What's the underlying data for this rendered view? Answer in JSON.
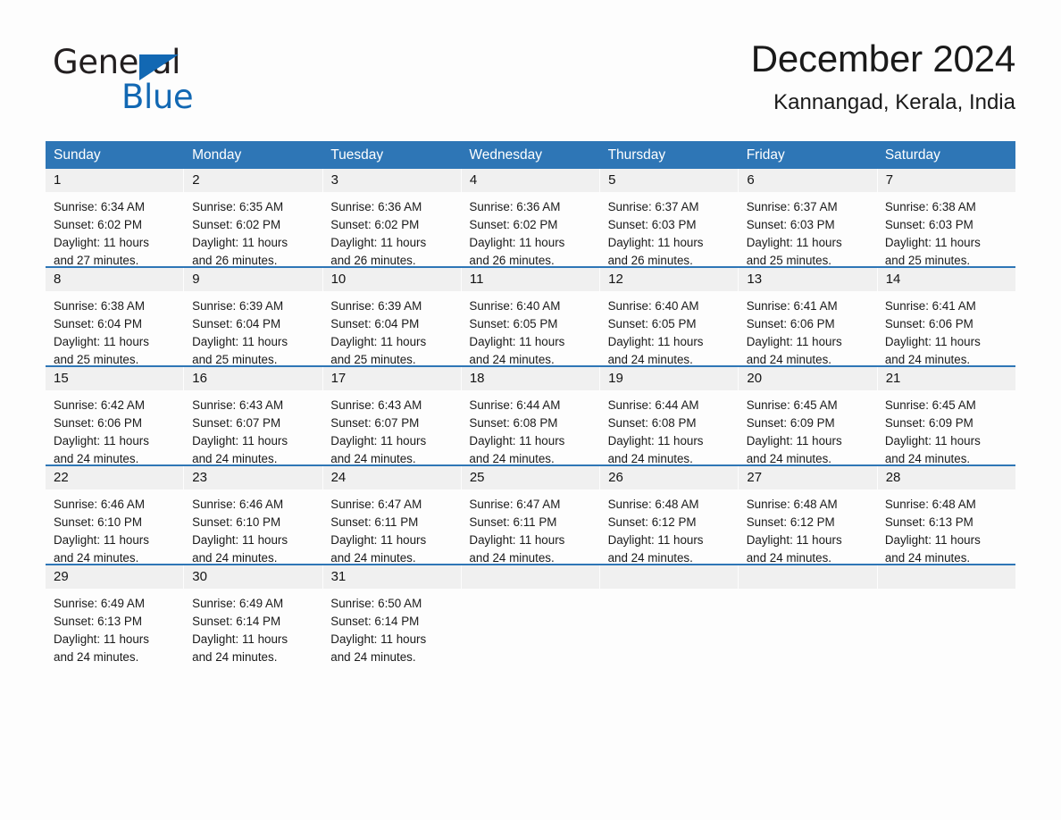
{
  "brand": {
    "name_top": "General",
    "name_bottom": "Blue",
    "triangle_color": "#1268b3"
  },
  "header": {
    "title": "December 2024",
    "subtitle": "Kannangad, Kerala, India"
  },
  "theme": {
    "header_blue": "#2e76b6",
    "daynum_gray": "#f0f0f0",
    "page_background": "#fdfdfd",
    "text_color": "#1a1a1a"
  },
  "weekdays": [
    "Sunday",
    "Monday",
    "Tuesday",
    "Wednesday",
    "Thursday",
    "Friday",
    "Saturday"
  ],
  "labels": {
    "sunrise_prefix": "Sunrise:",
    "sunset_prefix": "Sunset:",
    "daylight_prefix": "Daylight:"
  },
  "weeks": [
    {
      "days": [
        {
          "date": "1",
          "line1": "Sunrise: 6:34 AM",
          "line2": "Sunset: 6:02 PM",
          "line3": "Daylight: 11 hours",
          "line4": "and 27 minutes."
        },
        {
          "date": "2",
          "line1": "Sunrise: 6:35 AM",
          "line2": "Sunset: 6:02 PM",
          "line3": "Daylight: 11 hours",
          "line4": "and 26 minutes."
        },
        {
          "date": "3",
          "line1": "Sunrise: 6:36 AM",
          "line2": "Sunset: 6:02 PM",
          "line3": "Daylight: 11 hours",
          "line4": "and 26 minutes."
        },
        {
          "date": "4",
          "line1": "Sunrise: 6:36 AM",
          "line2": "Sunset: 6:02 PM",
          "line3": "Daylight: 11 hours",
          "line4": "and 26 minutes."
        },
        {
          "date": "5",
          "line1": "Sunrise: 6:37 AM",
          "line2": "Sunset: 6:03 PM",
          "line3": "Daylight: 11 hours",
          "line4": "and 26 minutes."
        },
        {
          "date": "6",
          "line1": "Sunrise: 6:37 AM",
          "line2": "Sunset: 6:03 PM",
          "line3": "Daylight: 11 hours",
          "line4": "and 25 minutes."
        },
        {
          "date": "7",
          "line1": "Sunrise: 6:38 AM",
          "line2": "Sunset: 6:03 PM",
          "line3": "Daylight: 11 hours",
          "line4": "and 25 minutes."
        }
      ]
    },
    {
      "days": [
        {
          "date": "8",
          "line1": "Sunrise: 6:38 AM",
          "line2": "Sunset: 6:04 PM",
          "line3": "Daylight: 11 hours",
          "line4": "and 25 minutes."
        },
        {
          "date": "9",
          "line1": "Sunrise: 6:39 AM",
          "line2": "Sunset: 6:04 PM",
          "line3": "Daylight: 11 hours",
          "line4": "and 25 minutes."
        },
        {
          "date": "10",
          "line1": "Sunrise: 6:39 AM",
          "line2": "Sunset: 6:04 PM",
          "line3": "Daylight: 11 hours",
          "line4": "and 25 minutes."
        },
        {
          "date": "11",
          "line1": "Sunrise: 6:40 AM",
          "line2": "Sunset: 6:05 PM",
          "line3": "Daylight: 11 hours",
          "line4": "and 24 minutes."
        },
        {
          "date": "12",
          "line1": "Sunrise: 6:40 AM",
          "line2": "Sunset: 6:05 PM",
          "line3": "Daylight: 11 hours",
          "line4": "and 24 minutes."
        },
        {
          "date": "13",
          "line1": "Sunrise: 6:41 AM",
          "line2": "Sunset: 6:06 PM",
          "line3": "Daylight: 11 hours",
          "line4": "and 24 minutes."
        },
        {
          "date": "14",
          "line1": "Sunrise: 6:41 AM",
          "line2": "Sunset: 6:06 PM",
          "line3": "Daylight: 11 hours",
          "line4": "and 24 minutes."
        }
      ]
    },
    {
      "days": [
        {
          "date": "15",
          "line1": "Sunrise: 6:42 AM",
          "line2": "Sunset: 6:06 PM",
          "line3": "Daylight: 11 hours",
          "line4": "and 24 minutes."
        },
        {
          "date": "16",
          "line1": "Sunrise: 6:43 AM",
          "line2": "Sunset: 6:07 PM",
          "line3": "Daylight: 11 hours",
          "line4": "and 24 minutes."
        },
        {
          "date": "17",
          "line1": "Sunrise: 6:43 AM",
          "line2": "Sunset: 6:07 PM",
          "line3": "Daylight: 11 hours",
          "line4": "and 24 minutes."
        },
        {
          "date": "18",
          "line1": "Sunrise: 6:44 AM",
          "line2": "Sunset: 6:08 PM",
          "line3": "Daylight: 11 hours",
          "line4": "and 24 minutes."
        },
        {
          "date": "19",
          "line1": "Sunrise: 6:44 AM",
          "line2": "Sunset: 6:08 PM",
          "line3": "Daylight: 11 hours",
          "line4": "and 24 minutes."
        },
        {
          "date": "20",
          "line1": "Sunrise: 6:45 AM",
          "line2": "Sunset: 6:09 PM",
          "line3": "Daylight: 11 hours",
          "line4": "and 24 minutes."
        },
        {
          "date": "21",
          "line1": "Sunrise: 6:45 AM",
          "line2": "Sunset: 6:09 PM",
          "line3": "Daylight: 11 hours",
          "line4": "and 24 minutes."
        }
      ]
    },
    {
      "days": [
        {
          "date": "22",
          "line1": "Sunrise: 6:46 AM",
          "line2": "Sunset: 6:10 PM",
          "line3": "Daylight: 11 hours",
          "line4": "and 24 minutes."
        },
        {
          "date": "23",
          "line1": "Sunrise: 6:46 AM",
          "line2": "Sunset: 6:10 PM",
          "line3": "Daylight: 11 hours",
          "line4": "and 24 minutes."
        },
        {
          "date": "24",
          "line1": "Sunrise: 6:47 AM",
          "line2": "Sunset: 6:11 PM",
          "line3": "Daylight: 11 hours",
          "line4": "and 24 minutes."
        },
        {
          "date": "25",
          "line1": "Sunrise: 6:47 AM",
          "line2": "Sunset: 6:11 PM",
          "line3": "Daylight: 11 hours",
          "line4": "and 24 minutes."
        },
        {
          "date": "26",
          "line1": "Sunrise: 6:48 AM",
          "line2": "Sunset: 6:12 PM",
          "line3": "Daylight: 11 hours",
          "line4": "and 24 minutes."
        },
        {
          "date": "27",
          "line1": "Sunrise: 6:48 AM",
          "line2": "Sunset: 6:12 PM",
          "line3": "Daylight: 11 hours",
          "line4": "and 24 minutes."
        },
        {
          "date": "28",
          "line1": "Sunrise: 6:48 AM",
          "line2": "Sunset: 6:13 PM",
          "line3": "Daylight: 11 hours",
          "line4": "and 24 minutes."
        }
      ]
    },
    {
      "days": [
        {
          "date": "29",
          "line1": "Sunrise: 6:49 AM",
          "line2": "Sunset: 6:13 PM",
          "line3": "Daylight: 11 hours",
          "line4": "and 24 minutes."
        },
        {
          "date": "30",
          "line1": "Sunrise: 6:49 AM",
          "line2": "Sunset: 6:14 PM",
          "line3": "Daylight: 11 hours",
          "line4": "and 24 minutes."
        },
        {
          "date": "31",
          "line1": "Sunrise: 6:50 AM",
          "line2": "Sunset: 6:14 PM",
          "line3": "Daylight: 11 hours",
          "line4": "and 24 minutes."
        },
        {
          "date": "",
          "line1": "",
          "line2": "",
          "line3": "",
          "line4": ""
        },
        {
          "date": "",
          "line1": "",
          "line2": "",
          "line3": "",
          "line4": ""
        },
        {
          "date": "",
          "line1": "",
          "line2": "",
          "line3": "",
          "line4": ""
        },
        {
          "date": "",
          "line1": "",
          "line2": "",
          "line3": "",
          "line4": ""
        }
      ]
    }
  ]
}
